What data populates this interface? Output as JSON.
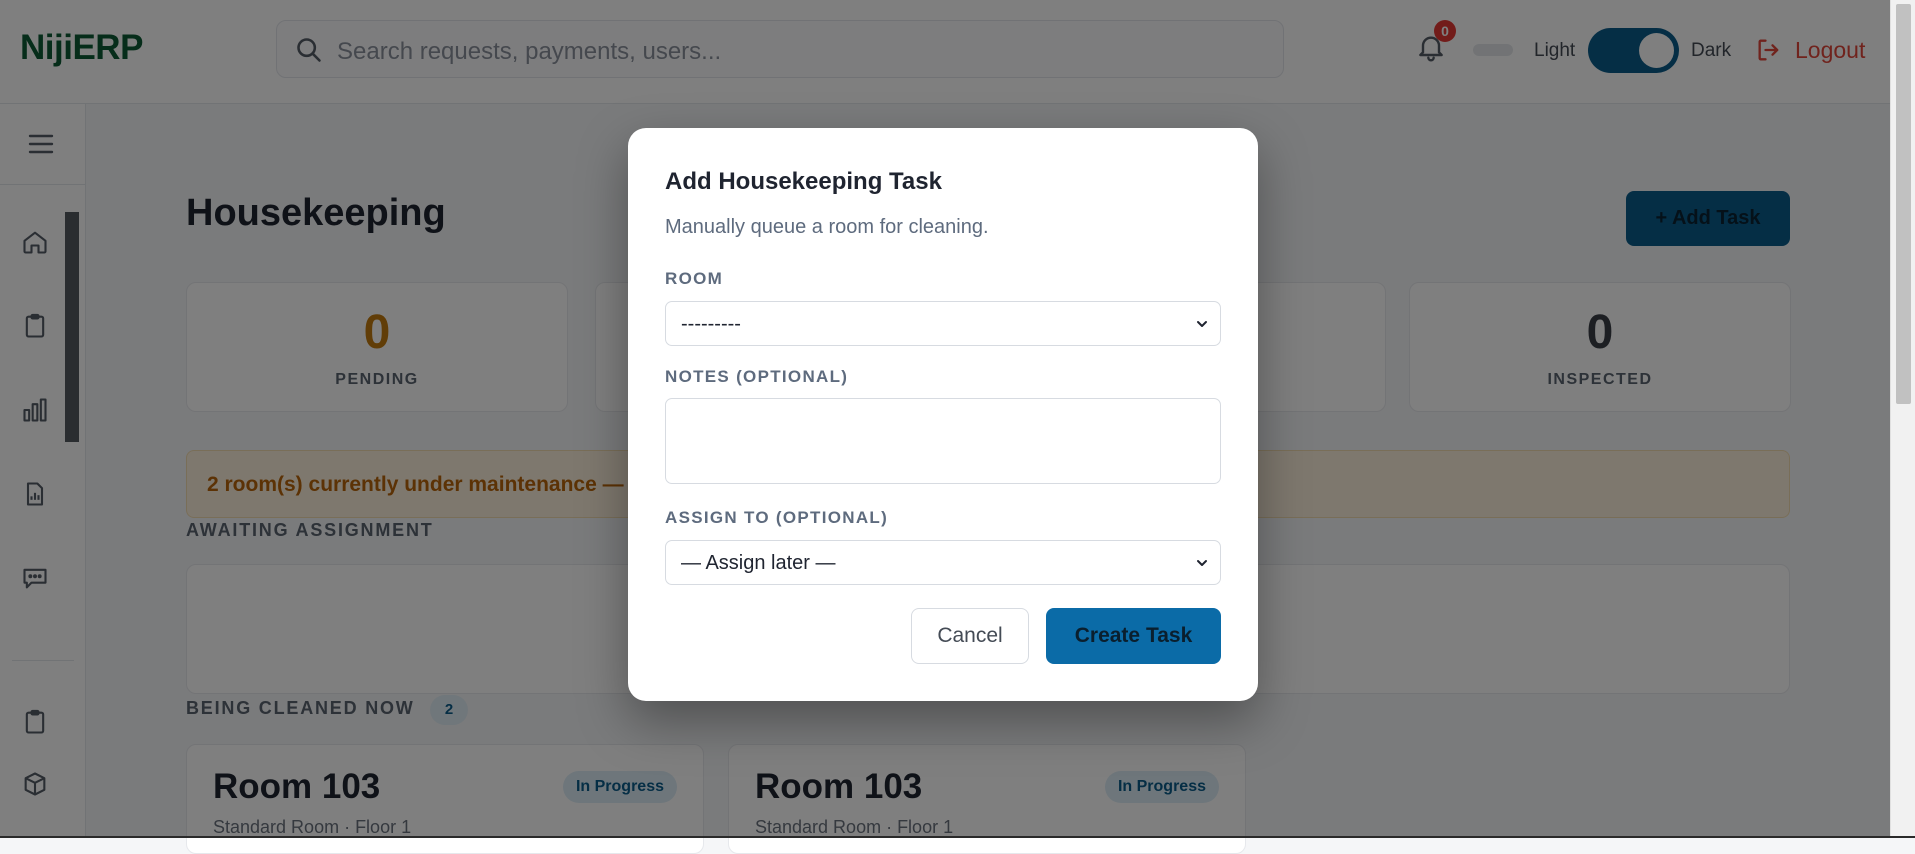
{
  "app": {
    "brand": "NijiERP"
  },
  "search": {
    "placeholder": "Search requests, payments, users..."
  },
  "header": {
    "notifications_count": "0",
    "theme_light_label": "Light",
    "theme_dark_label": "Dark",
    "logout_label": "Logout"
  },
  "page": {
    "title": "Housekeeping",
    "add_task_label": "+ Add Task",
    "stats": [
      {
        "value": "0",
        "label": "PENDING",
        "color": "#c27a0e"
      },
      {
        "value": "0",
        "label": "INSPECTED",
        "color": "#3a3f47"
      }
    ],
    "maintenance_banner": "2 room(s) currently under maintenance —",
    "awaiting_heading": "AWAITING ASSIGNMENT",
    "cleaning_heading": "BEING CLEANED NOW",
    "cleaning_count": "2",
    "rooms": [
      {
        "name": "Room 103",
        "subtitle": "Standard Room · Floor 1",
        "status": "In Progress"
      },
      {
        "name": "Room 103",
        "subtitle": "Standard Room · Floor 1",
        "status": "In Progress"
      }
    ]
  },
  "modal": {
    "title": "Add Housekeeping Task",
    "subtitle": "Manually queue a room for cleaning.",
    "room_label": "ROOM",
    "room_value": "---------",
    "notes_label": "NOTES (OPTIONAL)",
    "notes_value": "",
    "assign_label": "ASSIGN TO (OPTIONAL)",
    "assign_value": "— Assign later —",
    "cancel_label": "Cancel",
    "create_label": "Create Task"
  },
  "colors": {
    "brand": "#0d5a34",
    "primary": "#0b6ba7",
    "logout": "#e0463a",
    "warning": "#b8650a"
  }
}
